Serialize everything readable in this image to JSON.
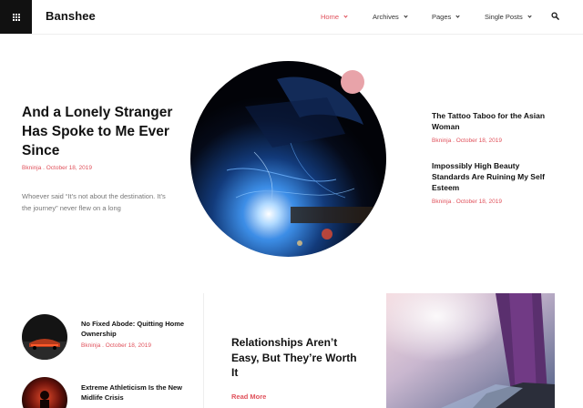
{
  "header": {
    "logo": "Banshee",
    "nav": [
      {
        "label": "Home"
      },
      {
        "label": "Archives"
      },
      {
        "label": "Pages"
      },
      {
        "label": "Single Posts"
      }
    ],
    "icons": {
      "menu": "grid-icon",
      "search": "search-icon"
    },
    "accent_color": "#e0515b"
  },
  "hero": {
    "title": "And a Lonely Stranger Has Spoke to Me Ever Since",
    "meta": "Bkninja . October 18, 2019",
    "excerpt": "Whoever said “It’s not about the destination. It’s the journey” never flew on a long"
  },
  "side_posts": [
    {
      "title": "The Tattoo Taboo for the Asian Woman",
      "meta": "Bkninja . October 18, 2019"
    },
    {
      "title": "Impossibly High Beauty Standards Are Ruining My Self Esteem",
      "meta": "Bkninja . October 18, 2019"
    }
  ],
  "small_posts": [
    {
      "title": "No Fixed Abode: Quitting Home Ownership",
      "meta": "Bkninja . October 18, 2019"
    },
    {
      "title": "Extreme Athleticism Is the New Midlife Crisis"
    }
  ],
  "feature": {
    "title": "Relationships Aren’t Easy, But They’re Worth It",
    "read_more": "Read More"
  }
}
